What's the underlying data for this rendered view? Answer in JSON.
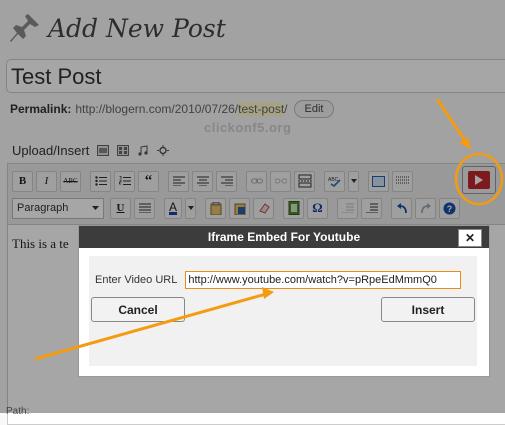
{
  "page": {
    "title": "Add New Post"
  },
  "post": {
    "title_value": "Test Post",
    "permalink_label": "Permalink:",
    "permalink_base": "http://blogern.com/2010/07/26/",
    "permalink_slug": "test-post",
    "permalink_end": "/",
    "edit_label": "Edit"
  },
  "watermark": "clickonf5.org",
  "upload": {
    "label": "Upload/Insert"
  },
  "editor": {
    "format_value": "Paragraph",
    "content_text": "This is a te",
    "path_text": "Path:"
  },
  "toolbar": {
    "bold": "B",
    "italic": "I",
    "strike": "ABC",
    "underline": "U",
    "font_color": "A",
    "special_char": "Ω"
  },
  "dialog": {
    "title": "Iframe Embed For Youtube",
    "close": "✕",
    "url_label": "Enter Video URL",
    "url_value": "http://www.youtube.com/watch?v=pRpeEdMmmQ0",
    "cancel_label": "Cancel",
    "insert_label": "Insert"
  },
  "colors": {
    "annotation": "#f39c12",
    "youtube_red": "#c0282d"
  }
}
